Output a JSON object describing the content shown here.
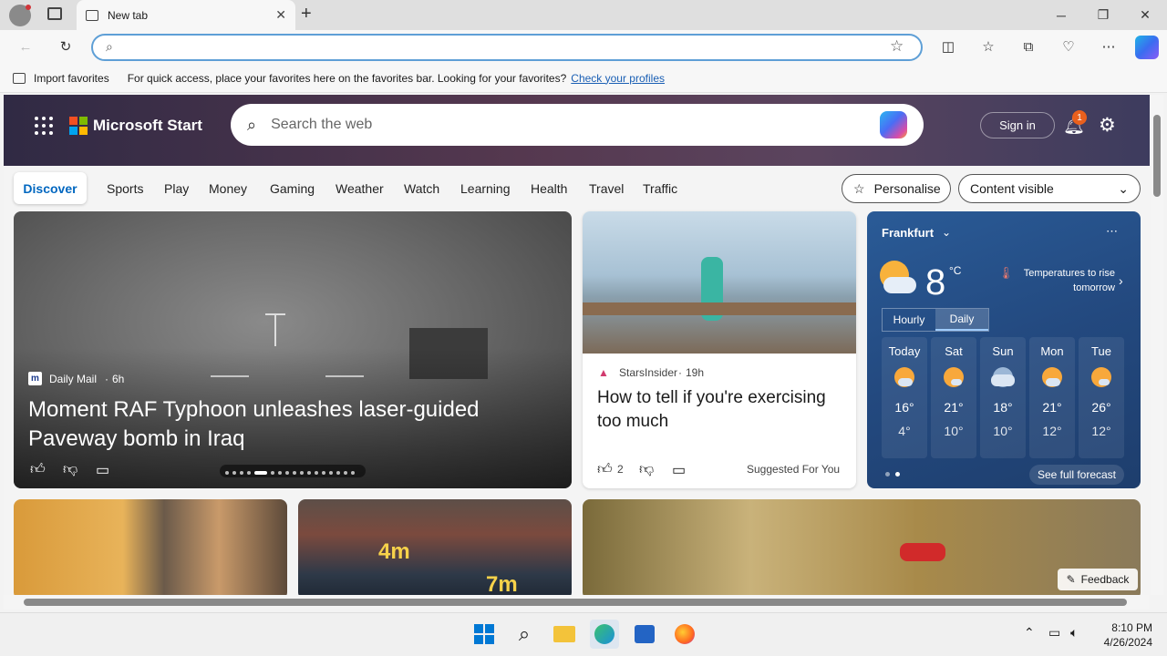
{
  "browser": {
    "tab_title": "New tab",
    "address_value": "",
    "fav_message": "For quick access, place your favorites here on the favorites bar. Looking for your favorites?",
    "fav_link": "Check your profiles",
    "import_label": "Import favorites"
  },
  "start": {
    "brand": "Microsoft Start",
    "search_placeholder": "Search the web",
    "signin_label": "Sign in",
    "notification_count": "1",
    "nav": [
      "Discover",
      "Sports",
      "Play",
      "Money",
      "Gaming",
      "Weather",
      "Watch",
      "Learning",
      "Health",
      "Travel",
      "Traffic"
    ],
    "personalise_label": "Personalise",
    "content_label": "Content visible"
  },
  "hero": {
    "source": "Daily Mail",
    "age": "6h",
    "headline": "Moment RAF Typhoon unleashes laser-guided Paveway bomb in Iraq"
  },
  "story2": {
    "source": "StarsInsider",
    "age": "19h",
    "headline": "How to tell if you're exercising too much",
    "likes": "2",
    "tag": "Suggested For You"
  },
  "weather": {
    "city": "Frankfurt",
    "temp": "8",
    "unit": "°C",
    "note": "Temperatures to rise tomorrow",
    "tabs": [
      "Hourly",
      "Daily"
    ],
    "days": [
      {
        "name": "Today",
        "high": "16°",
        "low": "4°"
      },
      {
        "name": "Sat",
        "high": "21°",
        "low": "10°"
      },
      {
        "name": "Sun",
        "high": "18°",
        "low": "10°"
      },
      {
        "name": "Mon",
        "high": "21°",
        "low": "12°"
      },
      {
        "name": "Tue",
        "high": "26°",
        "low": "12°"
      }
    ],
    "forecast_link": "See full forecast"
  },
  "bottom_cards": {
    "roof_label_a": "4m",
    "roof_label_b": "7m",
    "feedback": "Feedback"
  },
  "clock": {
    "time": "8:10 PM",
    "date": "4/26/2024"
  },
  "colors": {
    "accent": "#0067c0",
    "notif": "#e9601d",
    "weather_bg": "#23497f"
  }
}
